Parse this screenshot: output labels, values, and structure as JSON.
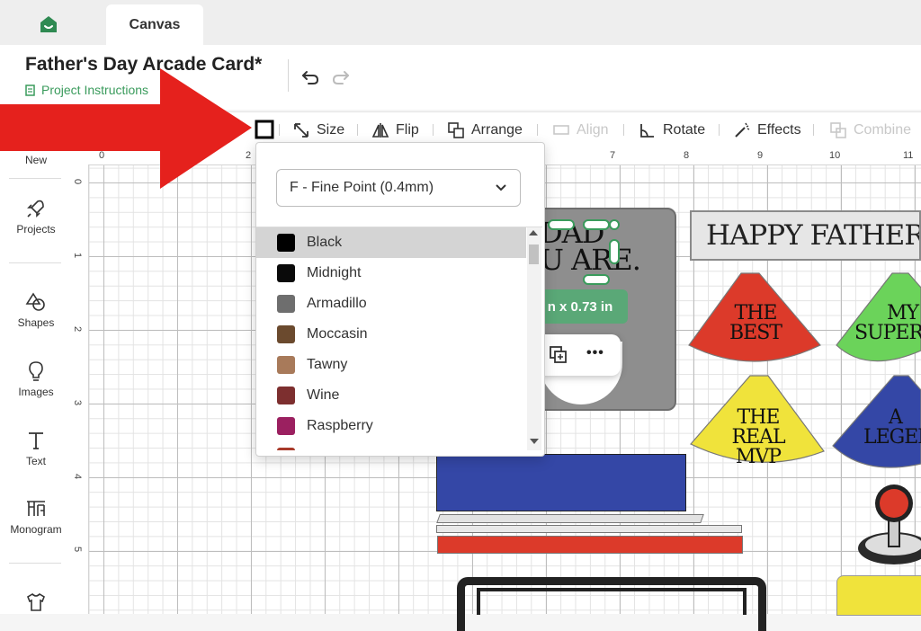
{
  "tabs": {
    "home_icon": "home-icon",
    "canvas_label": "Canvas"
  },
  "header": {
    "title": "Father's Day Arcade Card*",
    "instructions_label": "Project Instructions"
  },
  "toolbar": {
    "size": "Size",
    "flip": "Flip",
    "arrange": "Arrange",
    "align": "Align",
    "rotate": "Rotate",
    "effects": "Effects",
    "combine": "Combine"
  },
  "sidebar": {
    "new": "New",
    "projects": "Projects",
    "shapes": "Shapes",
    "images": "Images",
    "text": "Text",
    "monogram": "Monogram"
  },
  "rulers": {
    "top": [
      "0",
      "2",
      "7",
      "8",
      "9",
      "10",
      "11"
    ],
    "left": [
      "0",
      "1",
      "2",
      "3",
      "4",
      "5"
    ]
  },
  "canvas": {
    "dad_line1": "DAD",
    "dad_line2": "U ARE.",
    "size_badge": "n x 0.73  in",
    "more_label": "•••",
    "banner": "HAPPY FATHER'S DAY",
    "fan1": [
      "THE",
      "BEST"
    ],
    "fan2": [
      "MY",
      "SUPERHERO"
    ],
    "fan3": [
      "THE",
      "REAL MVP"
    ],
    "fan4": [
      "A",
      "LEGEND"
    ]
  },
  "pen_panel": {
    "selected_pen": "F - Fine Point (0.4mm)",
    "colors": [
      {
        "name": "Black",
        "hex": "#000000",
        "selected": true
      },
      {
        "name": "Midnight",
        "hex": "#0a0a0a"
      },
      {
        "name": "Armadillo",
        "hex": "#6e6e6e"
      },
      {
        "name": "Moccasin",
        "hex": "#6b4a2e"
      },
      {
        "name": "Tawny",
        "hex": "#a87a5a"
      },
      {
        "name": "Wine",
        "hex": "#7d2f2f"
      },
      {
        "name": "Raspberry",
        "hex": "#9b2060"
      },
      {
        "name": "",
        "hex": "#a83a2a"
      }
    ]
  },
  "colors": {
    "accent_green": "#3a9b5c",
    "arrow_red": "#e5211d"
  }
}
